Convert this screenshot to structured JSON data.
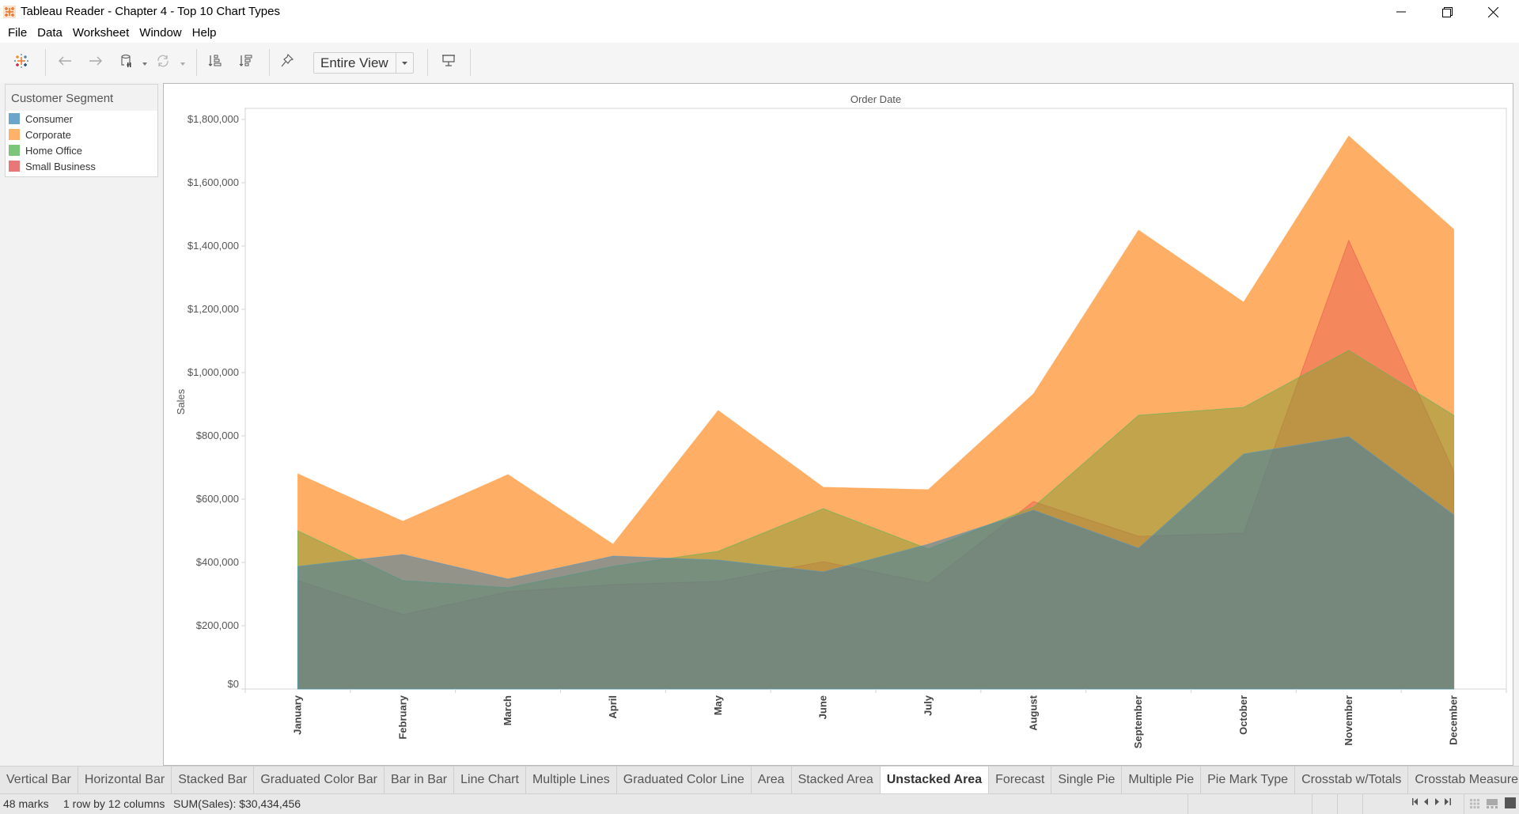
{
  "window": {
    "title": "Tableau Reader - Chapter 4 - Top 10 Chart Types",
    "app_icon": "tableau-logo-icon",
    "controls": [
      "minimize-icon",
      "restore-icon",
      "close-icon"
    ]
  },
  "menu": {
    "items": [
      "File",
      "Data",
      "Worksheet",
      "Window",
      "Help"
    ]
  },
  "toolbar": {
    "icons": [
      "tableau-logo-icon",
      "undo-arrow-icon",
      "redo-arrow-icon",
      "pause-data-updates-icon",
      "refresh-icon",
      "sort-ascending-icon",
      "sort-descending-icon",
      "highlight-pin-icon",
      "presentation-mode-icon"
    ],
    "fit_select": {
      "value": "Entire View"
    }
  },
  "legend": {
    "title": "Customer Segment",
    "items": [
      {
        "label": "Consumer",
        "color": "#4e97c6"
      },
      {
        "label": "Corporate",
        "color": "#ffa14a"
      },
      {
        "label": "Home Office",
        "color": "#56b85a"
      },
      {
        "label": "Small Business",
        "color": "#e8594f"
      }
    ]
  },
  "chart_data": {
    "type": "area",
    "stacked": false,
    "title": "",
    "column_header": "Order Date",
    "xlabel": "",
    "ylabel": "Sales",
    "categories": [
      "January",
      "February",
      "March",
      "April",
      "May",
      "June",
      "July",
      "August",
      "September",
      "October",
      "November",
      "December"
    ],
    "ylim": [
      0,
      1850000
    ],
    "yticks": [
      0,
      200000,
      400000,
      600000,
      800000,
      1000000,
      1200000,
      1400000,
      1600000,
      1800000
    ],
    "ytick_labels": [
      "$0",
      "$200,000",
      "$400,000",
      "$600,000",
      "$800,000",
      "$1,000,000",
      "$1,200,000",
      "$1,400,000",
      "$1,600,000",
      "$1,800,000"
    ],
    "grid": false,
    "legend_position": "left",
    "series": [
      {
        "name": "Corporate",
        "color": "#ffa14a",
        "values": [
          680000,
          530000,
          677500,
          457500,
          880000,
          637500,
          630000,
          932500,
          1450000,
          1222500,
          1747500,
          1452500
        ]
      },
      {
        "name": "Small Business",
        "color": "#e8594f",
        "values": [
          342500,
          235000,
          307500,
          330000,
          340000,
          402500,
          335000,
          592500,
          482500,
          492500,
          1417500,
          687500
        ]
      },
      {
        "name": "Home Office",
        "color": "#56b85a",
        "values": [
          500000,
          342500,
          320000,
          387500,
          435000,
          570000,
          442500,
          575000,
          865000,
          890000,
          1070000,
          865000
        ]
      },
      {
        "name": "Consumer",
        "color": "#4e97c6",
        "values": [
          387500,
          425000,
          347500,
          420000,
          407500,
          370000,
          457500,
          565000,
          445000,
          742500,
          797500,
          550000
        ]
      }
    ]
  },
  "tabs": {
    "items": [
      "Vertical Bar",
      "Horizontal Bar",
      "Stacked Bar",
      "Graduated Color Bar",
      "Bar in Bar",
      "Line Chart",
      "Multiple Lines",
      "Graduated Color Line",
      "Area",
      "Stacked Area",
      "Unstacked Area",
      "Forecast",
      "Single Pie",
      "Multiple Pie",
      "Pie Mark Type",
      "Crosstab w/Totals",
      "Crosstab Measure Col"
    ],
    "active_index": 10
  },
  "status": {
    "marks": "48 marks",
    "dimensions": "1 row by 12 columns",
    "sum": "SUM(Sales): $30,434,456"
  }
}
